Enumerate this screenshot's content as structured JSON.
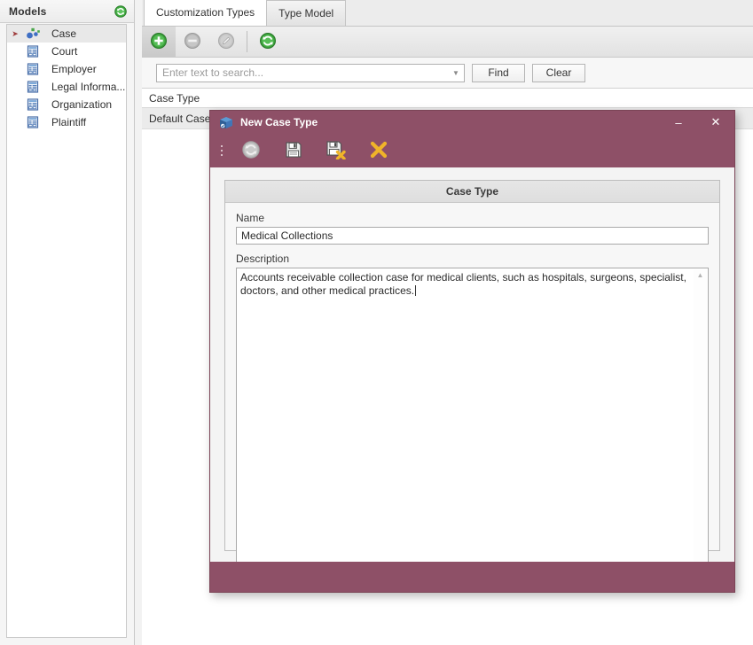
{
  "sidebar": {
    "header": {
      "title": "Models",
      "refresh_icon": "refresh-icon"
    },
    "items": [
      {
        "label": "Case",
        "icon": "model-nodes-icon",
        "selected": true,
        "expander": "➤"
      },
      {
        "label": "Court",
        "icon": "form-icon",
        "selected": false
      },
      {
        "label": "Employer",
        "icon": "form-icon",
        "selected": false
      },
      {
        "label": "Legal Informa...",
        "icon": "form-icon",
        "selected": false
      },
      {
        "label": "Organization",
        "icon": "form-icon",
        "selected": false
      },
      {
        "label": "Plaintiff",
        "icon": "form-icon",
        "selected": false
      }
    ]
  },
  "main": {
    "tabs": [
      {
        "label": "Customization Types",
        "active": true
      },
      {
        "label": "Type Model",
        "active": false
      }
    ],
    "toolbar": [
      {
        "name": "add-button",
        "icon": "green-plus-icon",
        "enabled": true
      },
      {
        "name": "remove-button",
        "icon": "gray-minus-icon",
        "enabled": false
      },
      {
        "name": "edit-button",
        "icon": "gray-pencil-icon",
        "enabled": false
      },
      {
        "name": "refresh-button",
        "icon": "green-refresh-icon",
        "enabled": true
      }
    ],
    "search": {
      "placeholder": "Enter text to search...",
      "value": "",
      "dropdown_icon": "chevron-down-icon",
      "find_label": "Find",
      "clear_label": "Clear"
    },
    "grid": {
      "column_header": "Case Type",
      "rows": [
        {
          "cells": [
            "Default Case T"
          ]
        }
      ]
    }
  },
  "dialog": {
    "title": "New Case Type",
    "title_icon": "cube-icon",
    "minimize_label": "–",
    "close_label": "✕",
    "accent_color": "#8e5067",
    "toolbar": [
      {
        "name": "dialog-refresh-button",
        "icon": "gray-refresh-icon",
        "enabled": false
      },
      {
        "name": "save-button",
        "icon": "floppy-save-icon",
        "enabled": true
      },
      {
        "name": "save-and-close-button",
        "icon": "floppy-save-close-icon",
        "enabled": true
      },
      {
        "name": "cancel-button",
        "icon": "yellow-x-icon",
        "enabled": true
      }
    ],
    "panel": {
      "caption": "Case Type",
      "name_label": "Name",
      "name_value": "Medical Collections",
      "description_label": "Description",
      "description_value": "Accounts receivable collection case for medical clients, such as hospitals, surgeons, specialist, doctors, and other medical practices.",
      "scroll_up_icon": "▲",
      "scroll_down_icon": "▼"
    }
  }
}
